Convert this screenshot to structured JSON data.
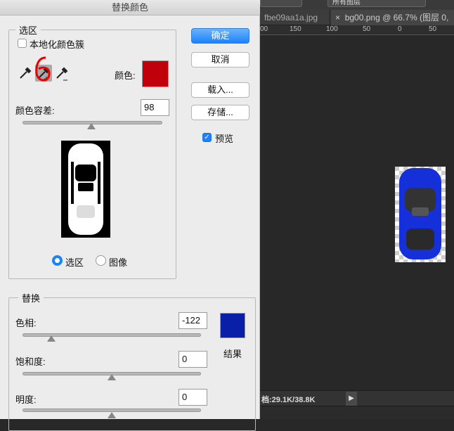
{
  "dialog": {
    "title": "替换颜色",
    "buttons": {
      "ok": "确定",
      "cancel": "取消",
      "load": "载入...",
      "save": "存储..."
    },
    "preview": {
      "label": "预览",
      "checked": true
    },
    "selection": {
      "legend": "选区",
      "localized_label": "本地化颜色簇",
      "localized_checked": false,
      "color_label": "颜色:",
      "color": "#c0000a",
      "fuzziness_label": "颜色容差:",
      "fuzziness": "98",
      "fuzziness_fraction": 0.49,
      "radio_selection": "选区",
      "radio_image": "图像",
      "selected_view": "选区",
      "tools": [
        "eyedropper-icon",
        "eyedropper-plus-icon",
        "eyedropper-minus-icon"
      ]
    },
    "replace": {
      "legend": "替换",
      "hue_label": "色相:",
      "hue": "-122",
      "hue_fraction": 0.16,
      "saturation_label": "饱和度:",
      "saturation": "0",
      "saturation_fraction": 0.5,
      "lightness_label": "明度:",
      "lightness": "0",
      "lightness_fraction": 0.5,
      "result_label": "结果",
      "result_color": "#0a1fa8"
    }
  },
  "app": {
    "top_dropdown": "所有图层",
    "tabs": [
      "fbe09aa1a.jpg",
      "bg00.png @ 66.7% (图层 0,"
    ],
    "tab_close": "×",
    "ruler": [
      "00",
      "150",
      "100",
      "50",
      "0",
      "50"
    ],
    "status": "档:29.1K/38.8K",
    "status_arrow": "▶"
  }
}
